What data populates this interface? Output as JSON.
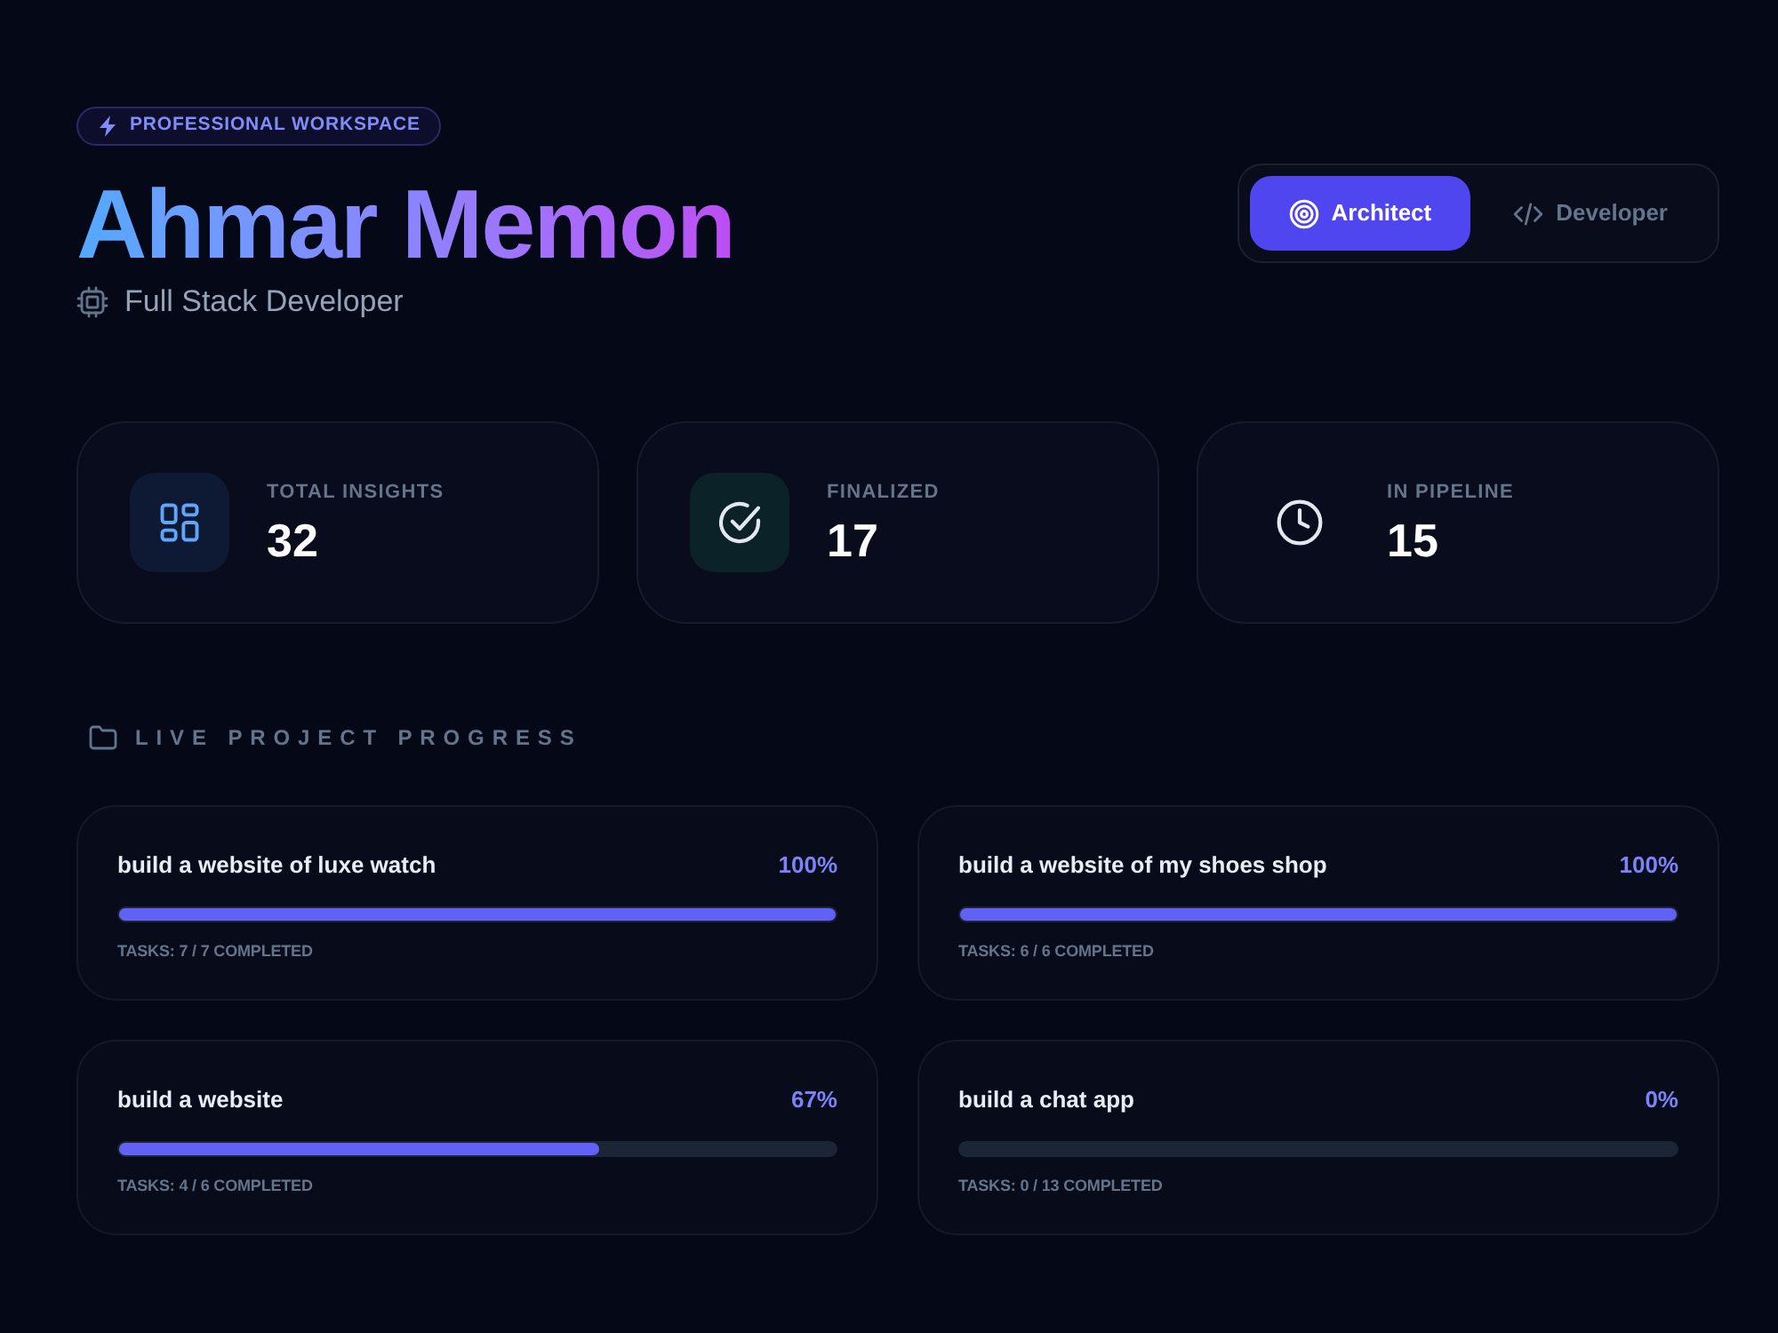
{
  "badge": {
    "label": "PROFESSIONAL WORKSPACE"
  },
  "profile": {
    "name": "Ahmar Memon",
    "role": "Full Stack Developer"
  },
  "view_toggle": [
    {
      "label": "Architect",
      "kind": "target",
      "selected": true
    },
    {
      "label": "Developer",
      "kind": "code",
      "selected": false
    }
  ],
  "stats": [
    {
      "kind": "grid",
      "label": "TOTAL INSIGHTS",
      "value": "32"
    },
    {
      "kind": "check",
      "label": "FINALIZED",
      "value": "17"
    },
    {
      "kind": "clock",
      "label": "IN PIPELINE",
      "value": "15"
    }
  ],
  "projects_section": {
    "title": "LIVE PROJECT PROGRESS",
    "projects": [
      {
        "title": "build a website of luxe watch",
        "percent": "100%",
        "level": 1,
        "tasks": "TASKS: 7 / 7 COMPLETED"
      },
      {
        "title": "build a website of my shoes shop",
        "percent": "100%",
        "level": 1,
        "tasks": "TASKS: 6 / 6 COMPLETED"
      },
      {
        "title": "build a website",
        "percent": "67%",
        "level": 0.67,
        "tasks": "TASKS: 4 / 6 COMPLETED"
      },
      {
        "title": "build a chat app",
        "percent": "0%",
        "level": 0,
        "tasks": "TASKS: 0 / 13 COMPLETED"
      }
    ]
  }
}
